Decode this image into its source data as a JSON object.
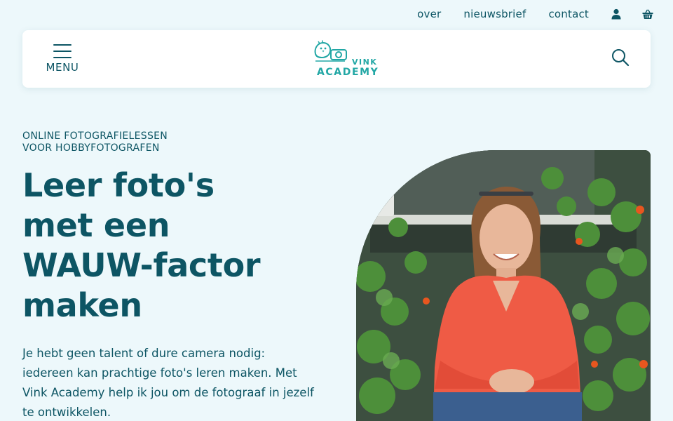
{
  "topnav": {
    "links": [
      "over",
      "nieuwsbrief",
      "contact"
    ],
    "account_icon": "user-icon",
    "cart_icon": "basket-icon"
  },
  "header": {
    "menu_label": "MENU",
    "logo": {
      "line1": "VINK",
      "line2": "ACADEMY"
    },
    "search_icon": "search-icon"
  },
  "hero": {
    "kicker_line1": "ONLINE FOTOGRAFIELESSEN",
    "kicker_line2": "VOOR HOBBYFOTOGRAFEN",
    "headline_lines": [
      "Leer foto's",
      "met een",
      "WAUW-factor",
      "maken"
    ],
    "intro_lines": [
      "Je hebt geen talent of dure camera nodig:",
      "iedereen kan prachtige foto's leren maken. Met",
      "Vink Academy help ik jou om de fotograaf in jezelf",
      "te ontwikkelen."
    ]
  },
  "colors": {
    "background": "#edf8fb",
    "primary_text": "#0d5564",
    "brand_teal": "#22a7a5",
    "card": "#ffffff"
  }
}
